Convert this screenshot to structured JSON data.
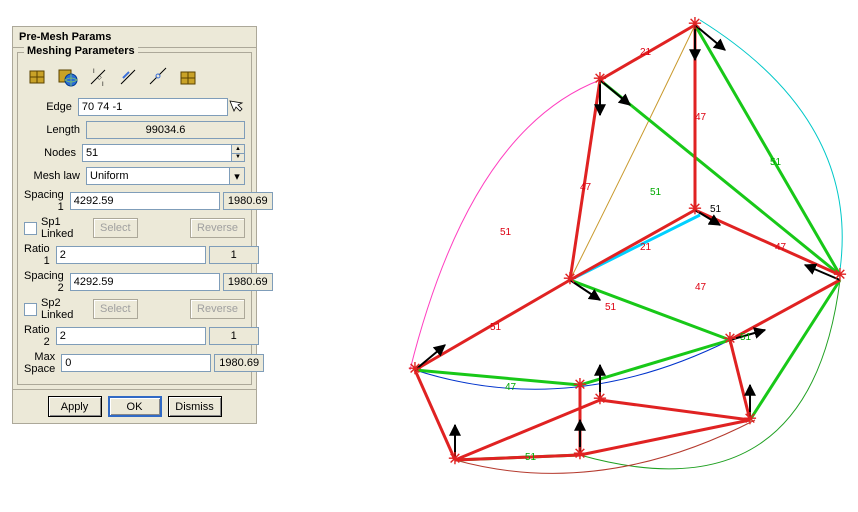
{
  "dialog": {
    "title": "Pre-Mesh Params",
    "group_label": "Meshing Parameters",
    "fields": {
      "edge_label": "Edge",
      "edge_value": "70 74 -1",
      "length_label": "Length",
      "length_value": "99034.6",
      "nodes_label": "Nodes",
      "nodes_value": "51",
      "meshlaw_label": "Mesh law",
      "meshlaw_value": "Uniform",
      "spacing1_label": "Spacing 1",
      "spacing1_value": "4292.59",
      "spacing1_ref": "1980.69",
      "sp1linked_label": "Sp1 Linked",
      "select_label": "Select",
      "reverse_label": "Reverse",
      "ratio1_label": "Ratio 1",
      "ratio1_value": "2",
      "ratio1_ref": "1",
      "spacing2_label": "Spacing 2",
      "spacing2_value": "4292.59",
      "spacing2_ref": "1980.69",
      "sp2linked_label": "Sp2 Linked",
      "ratio2_label": "Ratio 2",
      "ratio2_value": "2",
      "ratio2_ref": "1",
      "maxspace_label": "Max Space",
      "maxspace_value": "0",
      "maxspace_ref": "1980.69"
    },
    "buttons": {
      "apply": "Apply",
      "ok": "OK",
      "dismiss": "Dismiss"
    }
  },
  "viewport": {
    "edge_numbers": [
      "21",
      "47",
      "51",
      "47",
      "51",
      "51",
      "47",
      "21",
      "51",
      "47",
      "51",
      "47",
      "51",
      "51"
    ]
  }
}
